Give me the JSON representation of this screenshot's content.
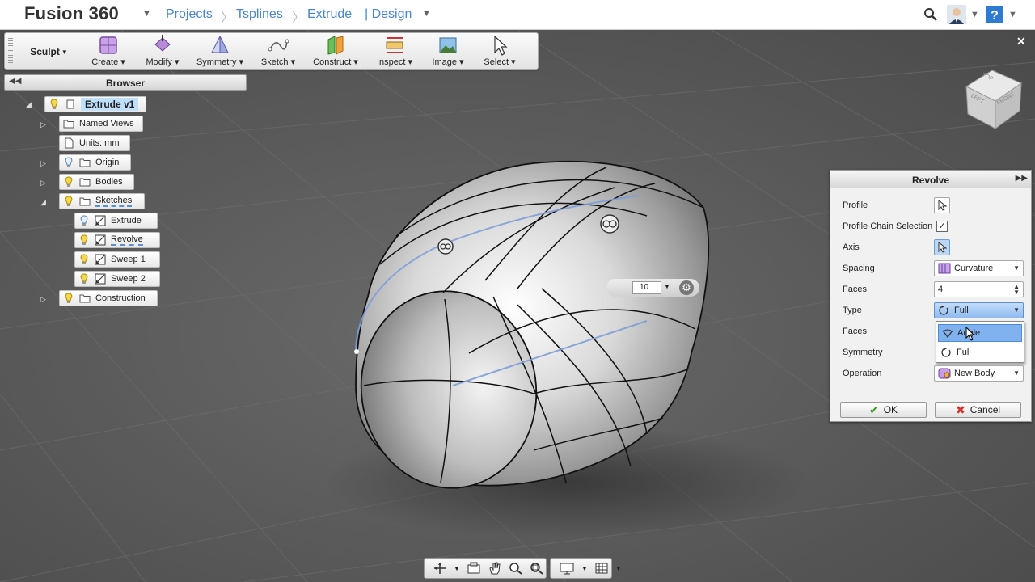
{
  "app": {
    "title": "Fusion 360",
    "breadcrumbs": [
      "Projects",
      "Tsplines",
      "Extrude",
      "| Design"
    ]
  },
  "toolbar": {
    "workspace": "Sculpt",
    "tools": [
      {
        "label": "Create",
        "icon": "create-box-icon"
      },
      {
        "label": "Modify",
        "icon": "modify-icon"
      },
      {
        "label": "Symmetry",
        "icon": "symmetry-icon"
      },
      {
        "label": "Sketch",
        "icon": "sketch-icon"
      },
      {
        "label": "Construct",
        "icon": "construct-icon"
      },
      {
        "label": "Inspect",
        "icon": "inspect-icon"
      },
      {
        "label": "Image",
        "icon": "image-icon"
      },
      {
        "label": "Select",
        "icon": "cursor-icon"
      }
    ]
  },
  "browser": {
    "title": "Browser",
    "root": "Extrude v1",
    "items": [
      {
        "label": "Named Views"
      },
      {
        "label": "Units: mm"
      },
      {
        "label": "Origin"
      },
      {
        "label": "Bodies"
      },
      {
        "label": "Sketches"
      },
      {
        "label": "Extrude"
      },
      {
        "label": "Revolve"
      },
      {
        "label": "Sweep 1"
      },
      {
        "label": "Sweep 2"
      },
      {
        "label": "Construction"
      }
    ]
  },
  "viewcube": {
    "top": "TOP",
    "left": "LEFT",
    "front": "FRONT"
  },
  "value_box": {
    "value": "10"
  },
  "revolve": {
    "title": "Revolve",
    "labels": {
      "profile": "Profile",
      "chain": "Profile Chain Selection",
      "axis": "Axis",
      "spacing": "Spacing",
      "faces": "Faces",
      "type": "Type",
      "faces2": "Faces",
      "symmetry": "Symmetry",
      "operation": "Operation"
    },
    "spacing_value": "Curvature",
    "faces_value": "4",
    "type_value": "Full",
    "type_options": [
      "Angle",
      "Full"
    ],
    "operation_value": "New Body",
    "ok": "OK",
    "cancel": "Cancel",
    "chain_checked": "✓"
  },
  "colors": {
    "accent": "#4a86c8",
    "highlight": "#7fb2ef",
    "viewport": "#5a5a5a"
  }
}
